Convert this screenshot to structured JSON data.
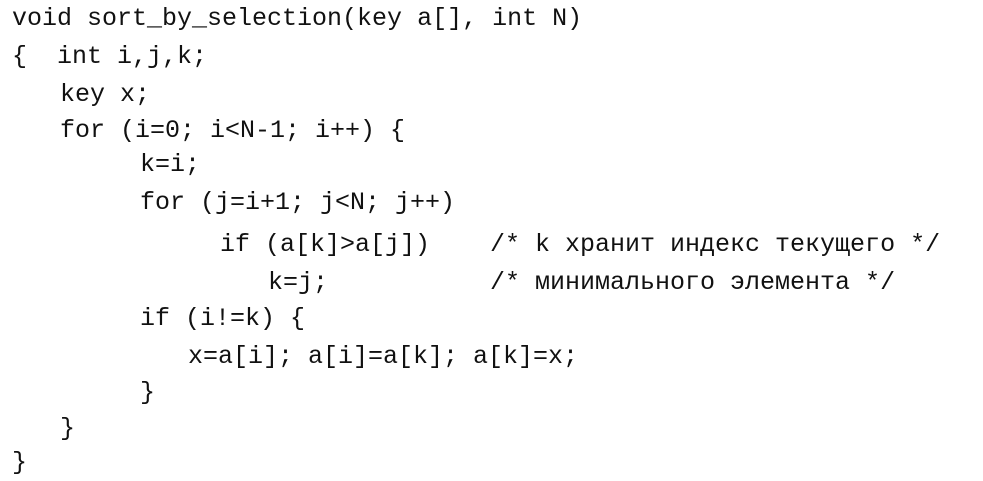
{
  "code": {
    "lines": [
      "void sort_by_selection(key a[], int N)",
      "{  int i,j,k;",
      "key x;",
      "for (i=0; i<N-1; i++) {",
      "k=i;",
      "for (j=i+1; j<N; j++)",
      "if (a[k]>a[j])",
      "k=j;",
      "if (i!=k) {",
      "x=a[i]; a[i]=a[k]; a[k]=x;",
      "}",
      "}",
      "}"
    ],
    "comments": [
      "/* k хранит индекс текущего */",
      "/* минимального элемента */"
    ]
  }
}
